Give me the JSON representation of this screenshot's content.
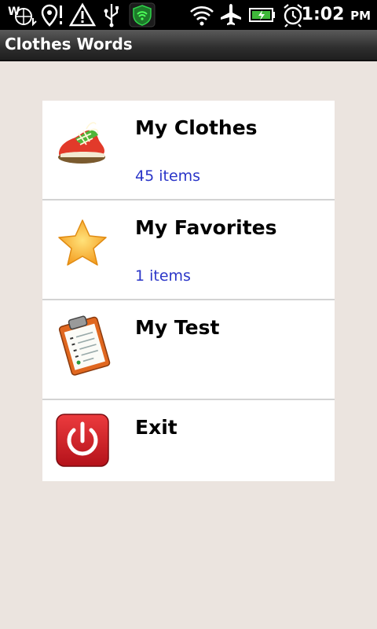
{
  "status_bar": {
    "time": "1:02",
    "ampm": "PM",
    "icons": [
      "wifi-location-icon",
      "map-pin-icon",
      "warning-icon",
      "usb-icon",
      "shield-wifi-icon",
      "wifi-signal-icon",
      "airplane-icon",
      "battery-icon",
      "alarm-icon"
    ]
  },
  "app": {
    "title": "Clothes Words"
  },
  "menu": {
    "items": [
      {
        "title": "My Clothes",
        "subtitle": "45 items",
        "icon": "shoe-icon"
      },
      {
        "title": "My Favorites",
        "subtitle": "1 items",
        "icon": "star-icon"
      },
      {
        "title": " My Test",
        "subtitle": "",
        "icon": "clipboard-icon"
      },
      {
        "title": "Exit",
        "subtitle": "",
        "icon": "power-icon"
      }
    ]
  },
  "colors": {
    "background": "#ebe4df",
    "subtitle": "#2a35c8",
    "exit_red": "#d7262b",
    "star": "#f6a623",
    "clipboard": "#e0671f",
    "shield_green": "#25c43a"
  }
}
